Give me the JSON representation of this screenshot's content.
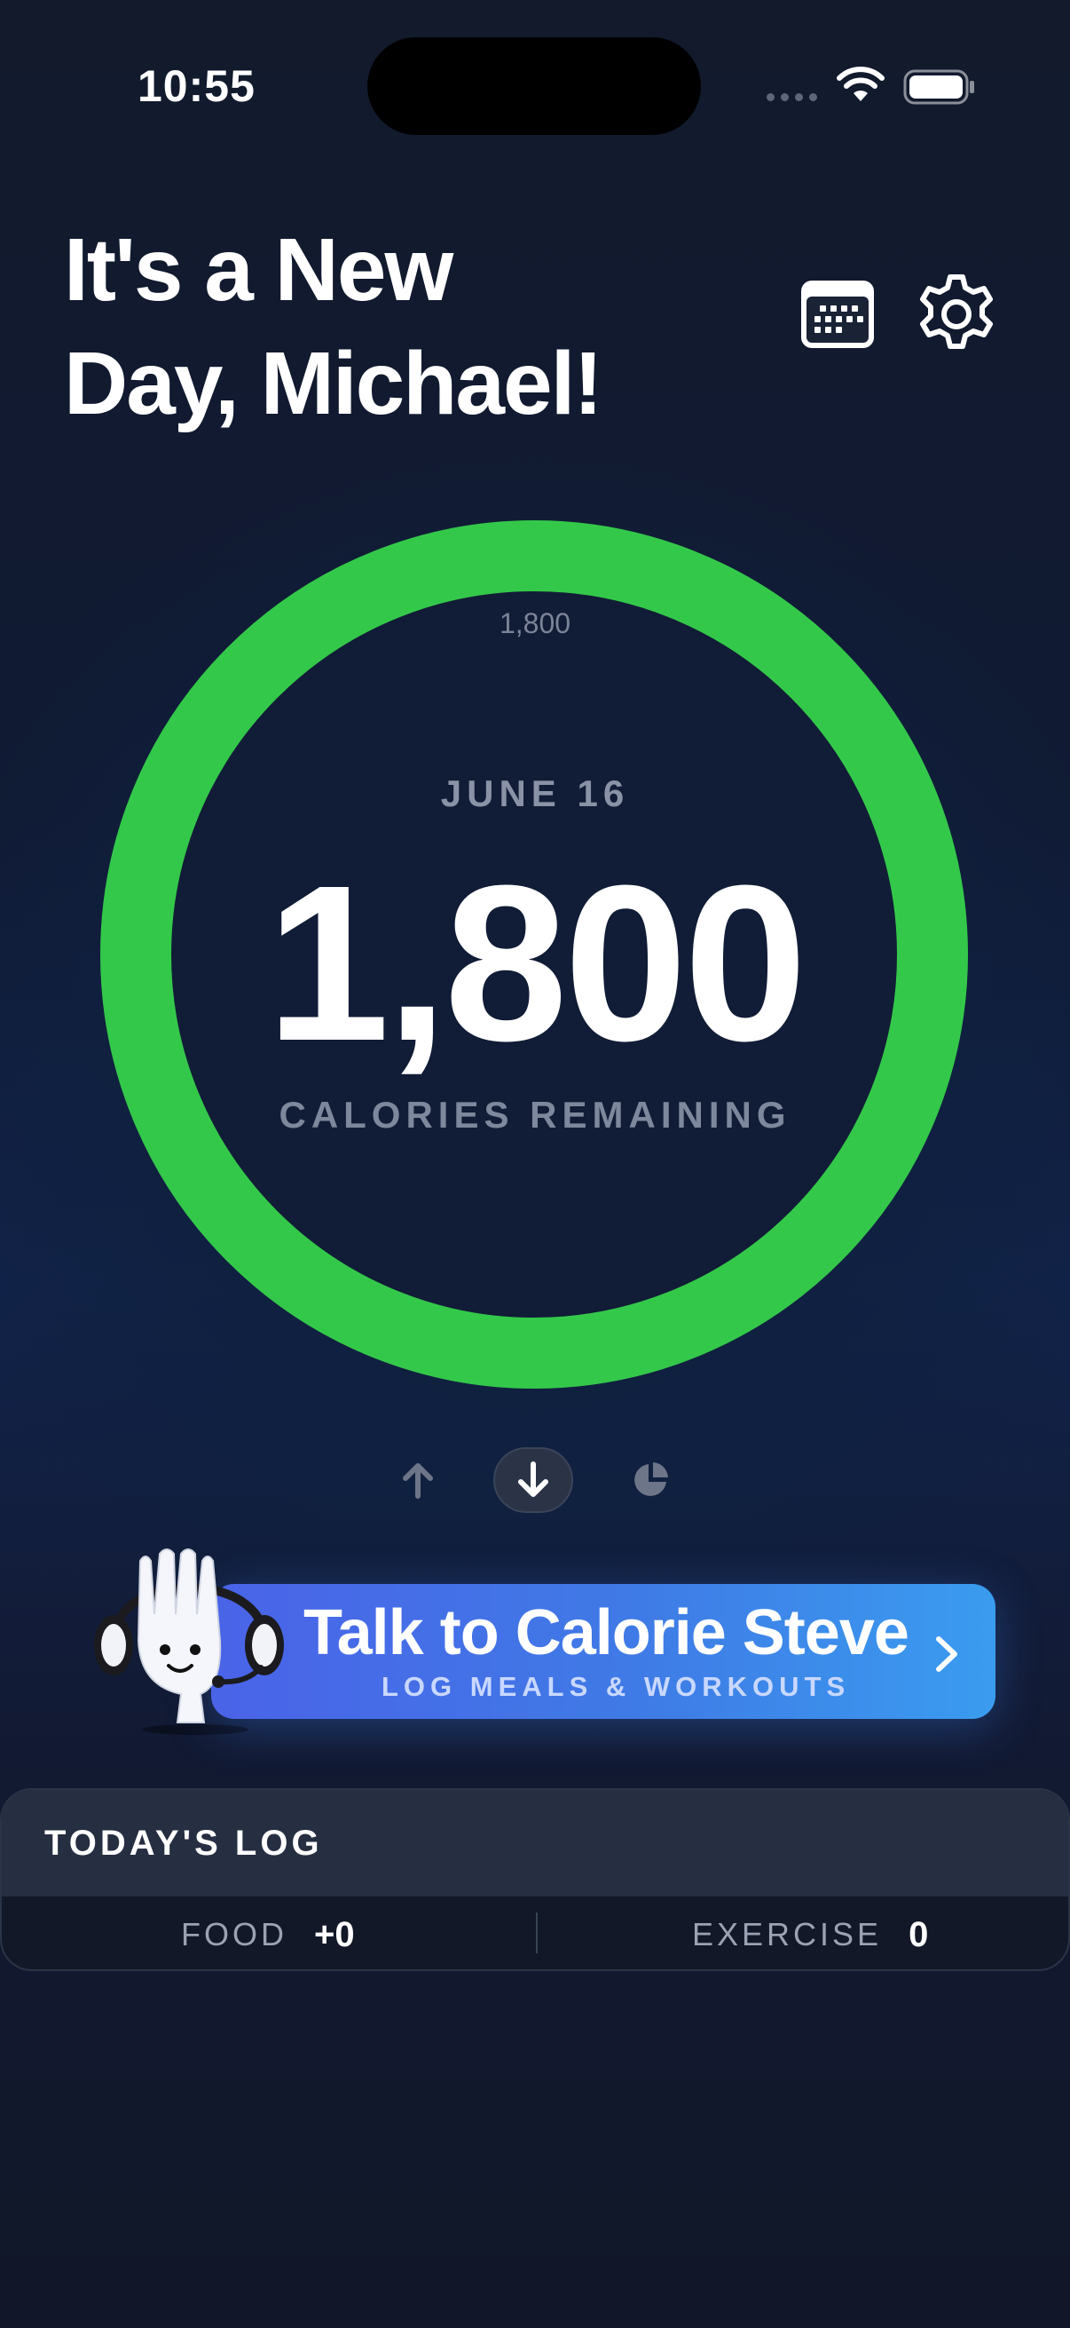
{
  "status_bar": {
    "time": "10:55"
  },
  "header": {
    "title_line1": "It's a New",
    "title_line2": "Day, Michael!"
  },
  "ring": {
    "goal": "1,800",
    "date": "JUNE 16",
    "remaining": "1,800",
    "label": "CALORIES REMAINING",
    "progress_fraction": 1.0,
    "color": "#34c84a"
  },
  "cta": {
    "title": "Talk to Calorie Steve",
    "subtitle": "LOG MEALS & WORKOUTS"
  },
  "log": {
    "title": "TODAY'S LOG",
    "food_label": "FOOD",
    "food_value": "+0",
    "exercise_label": "EXERCISE",
    "exercise_value": "0"
  },
  "icons": [
    "calendar-icon",
    "gear-icon",
    "arrow-up-icon",
    "arrow-down-icon",
    "pie-chart-icon",
    "chevron-right-icon",
    "fork-mascot-icon"
  ]
}
